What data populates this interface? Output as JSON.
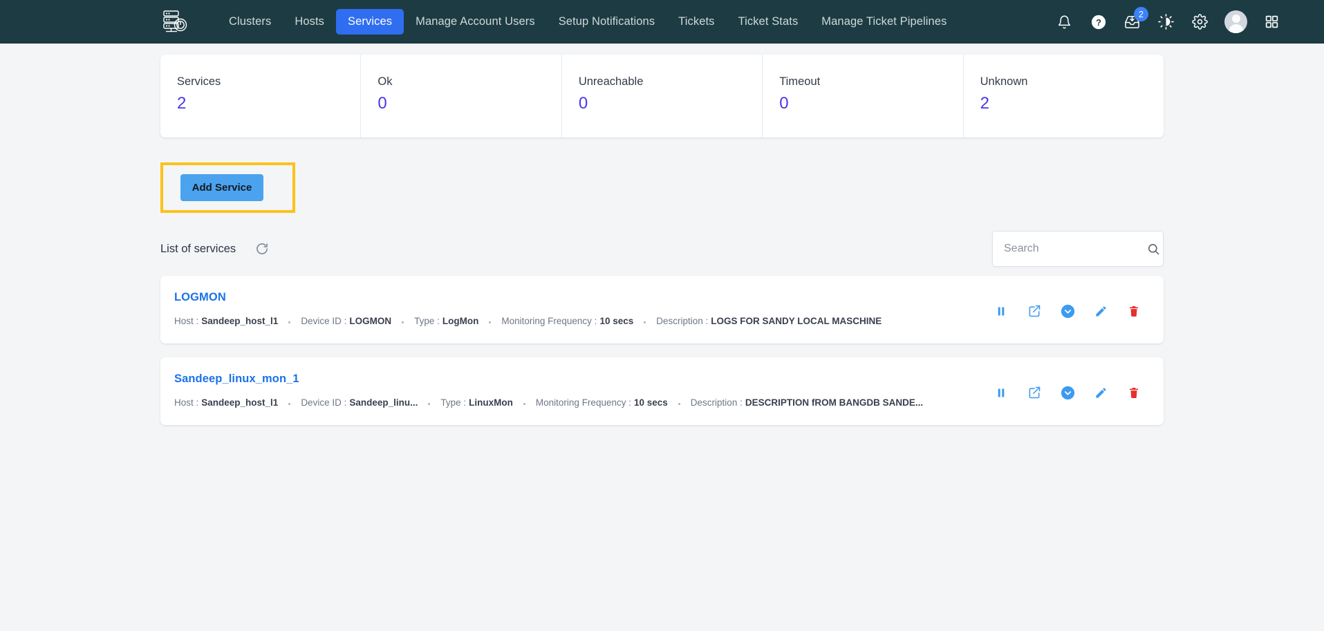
{
  "navbar": {
    "logo_icon": "server-rack-gauge-logo",
    "links": [
      {
        "label": "Clusters",
        "active": false
      },
      {
        "label": "Hosts",
        "active": false
      },
      {
        "label": "Services",
        "active": true
      },
      {
        "label": "Manage Account Users",
        "active": false
      },
      {
        "label": "Setup Notifications",
        "active": false
      },
      {
        "label": "Tickets",
        "active": false
      },
      {
        "label": "Ticket Stats",
        "active": false
      },
      {
        "label": "Manage Ticket Pipelines",
        "active": false
      }
    ],
    "icons": {
      "bell": "notifications-bell-icon",
      "help": "help-question-icon",
      "inbox": "inbox-download-icon",
      "inbox_badge": "2",
      "theme": "dark-mode-toggle-icon",
      "settings": "gear-settings-icon",
      "avatar": "user-avatar",
      "apps": "apps-grid-icon"
    },
    "active_color": "#2f6ef0",
    "background_color": "#1d3b42"
  },
  "stats": {
    "accent_color": "#4b37e8",
    "cards": [
      {
        "label": "Services",
        "value": "2"
      },
      {
        "label": "Ok",
        "value": "0"
      },
      {
        "label": "Unreachable",
        "value": "0"
      },
      {
        "label": "Timeout",
        "value": "0"
      },
      {
        "label": "Unknown",
        "value": "2"
      }
    ]
  },
  "toolbar": {
    "add_service_label": "Add Service",
    "add_service_color": "#4ba3ef",
    "highlight_color": "#fcc21b"
  },
  "list": {
    "title": "List of services",
    "refresh_icon": "refresh-icon",
    "search": {
      "placeholder": "Search",
      "value": "",
      "icon": "search-icon"
    }
  },
  "services": [
    {
      "name": "LOGMON",
      "meta": [
        {
          "key": "Host :",
          "value": "Sandeep_host_l1"
        },
        {
          "key": "Device ID :",
          "value": "LOGMON"
        },
        {
          "key": "Type :",
          "value": "LogMon"
        },
        {
          "key": "Monitoring Frequency :",
          "value": "10 secs"
        },
        {
          "key": "Description :",
          "value": "LOGS FOR SANDY LOCAL MASCHINE"
        }
      ],
      "actions": [
        {
          "name": "pause-icon",
          "label": "Pause"
        },
        {
          "name": "open-in-new-icon",
          "label": "Open"
        },
        {
          "name": "chevron-down-circle-icon",
          "label": "Expand"
        },
        {
          "name": "edit-pencil-icon",
          "label": "Edit"
        },
        {
          "name": "delete-trash-icon",
          "label": "Delete"
        }
      ]
    },
    {
      "name": "Sandeep_linux_mon_1",
      "meta": [
        {
          "key": "Host :",
          "value": "Sandeep_host_l1"
        },
        {
          "key": "Device ID :",
          "value": "Sandeep_linu..."
        },
        {
          "key": "Type :",
          "value": "LinuxMon"
        },
        {
          "key": "Monitoring Frequency :",
          "value": "10 secs"
        },
        {
          "key": "Description :",
          "value": "DESCRIPTION fROM BANGDB SANDE..."
        }
      ],
      "actions": [
        {
          "name": "pause-icon",
          "label": "Pause"
        },
        {
          "name": "open-in-new-icon",
          "label": "Open"
        },
        {
          "name": "chevron-down-circle-icon",
          "label": "Expand"
        },
        {
          "name": "edit-pencil-icon",
          "label": "Edit"
        },
        {
          "name": "delete-trash-icon",
          "label": "Delete"
        }
      ]
    }
  ]
}
